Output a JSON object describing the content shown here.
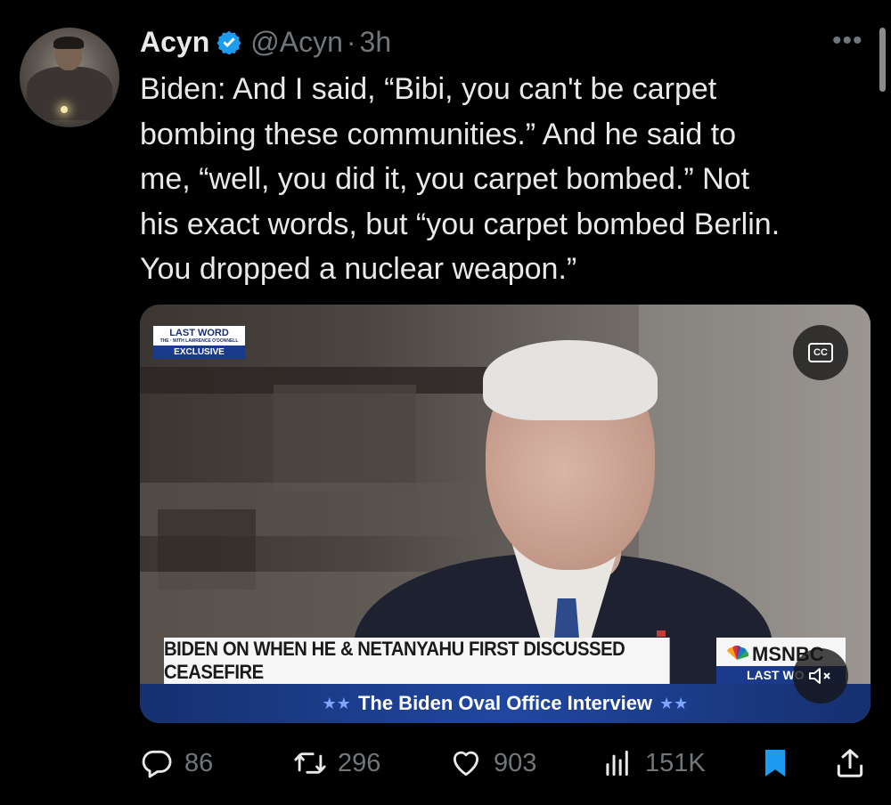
{
  "tweet": {
    "author_name": "Acyn",
    "handle": "@Acyn",
    "separator": "·",
    "time": "3h",
    "more_label": "•••",
    "text": "Biden: And I said, “Bibi, you can't be carpet\nbombing these communities.” And he said to\nme, “well, you did it, you carpet bombed.” Not\nhis exact words, but “you carpet bombed Berlin.\nYou dropped a nuclear weapon.”"
  },
  "video": {
    "badge_show": "LAST WORD",
    "badge_small": "THE · WITH LAWRENCE O'DONNELL",
    "badge_label": "EXCLUSIVE",
    "cc_label": "CC",
    "lower_third": "BIDEN ON WHEN HE & NETANYAHU FIRST DISCUSSED CEASEFIRE",
    "network": "MSNBC",
    "network_show": "LAST WO",
    "banner": "The Biden Oval Office Interview",
    "banner_stars": "★★"
  },
  "actions": {
    "replies": "86",
    "retweets": "296",
    "likes": "903",
    "views": "151K"
  },
  "colors": {
    "background": "#000000",
    "text": "#e7e9ea",
    "muted": "#71767b",
    "verified": "#1d9bf0",
    "bookmark": "#1d9bf0"
  },
  "icons": {
    "verified": "verified-badge-icon",
    "more": "more-dots-icon",
    "cc": "closed-captions-icon",
    "mute": "volume-muted-icon",
    "reply": "reply-bubble-icon",
    "retweet": "retweet-icon",
    "like": "heart-icon",
    "views": "bar-chart-icon",
    "bookmark": "bookmark-icon",
    "share": "share-icon"
  }
}
